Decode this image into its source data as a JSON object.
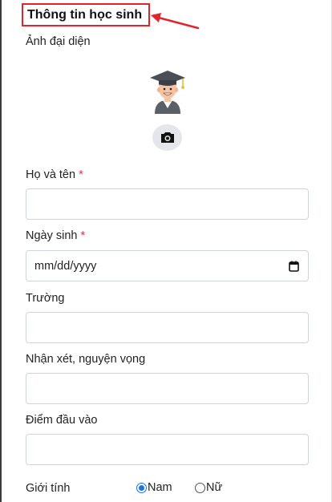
{
  "form": {
    "title": "Thông tin học sinh",
    "avatar_label": "Ảnh đại diện",
    "fields": [
      {
        "label": "Họ và tên",
        "required": true,
        "value": ""
      },
      {
        "label": "Ngày sinh",
        "required": true,
        "value": "mm/dd/yyyy"
      },
      {
        "label": "Trường",
        "required": false,
        "value": ""
      },
      {
        "label": "Nhận xét, nguyện vọng",
        "required": false,
        "value": ""
      },
      {
        "label": "Điểm đầu vào",
        "required": false,
        "value": ""
      }
    ],
    "required_marker": "*",
    "gender": {
      "label": "Giới tính",
      "options": [
        {
          "label": "Nam",
          "checked": true
        },
        {
          "label": "Nữ",
          "checked": false
        }
      ]
    }
  },
  "icons": {
    "avatar": "graduate-avatar-icon",
    "camera": "camera-icon",
    "calendar": "calendar-icon",
    "annotation_arrow": "red-arrow"
  },
  "colors": {
    "highlight": "#e0262c",
    "required": "#dc3545",
    "radio_accent": "#1a73e8"
  }
}
